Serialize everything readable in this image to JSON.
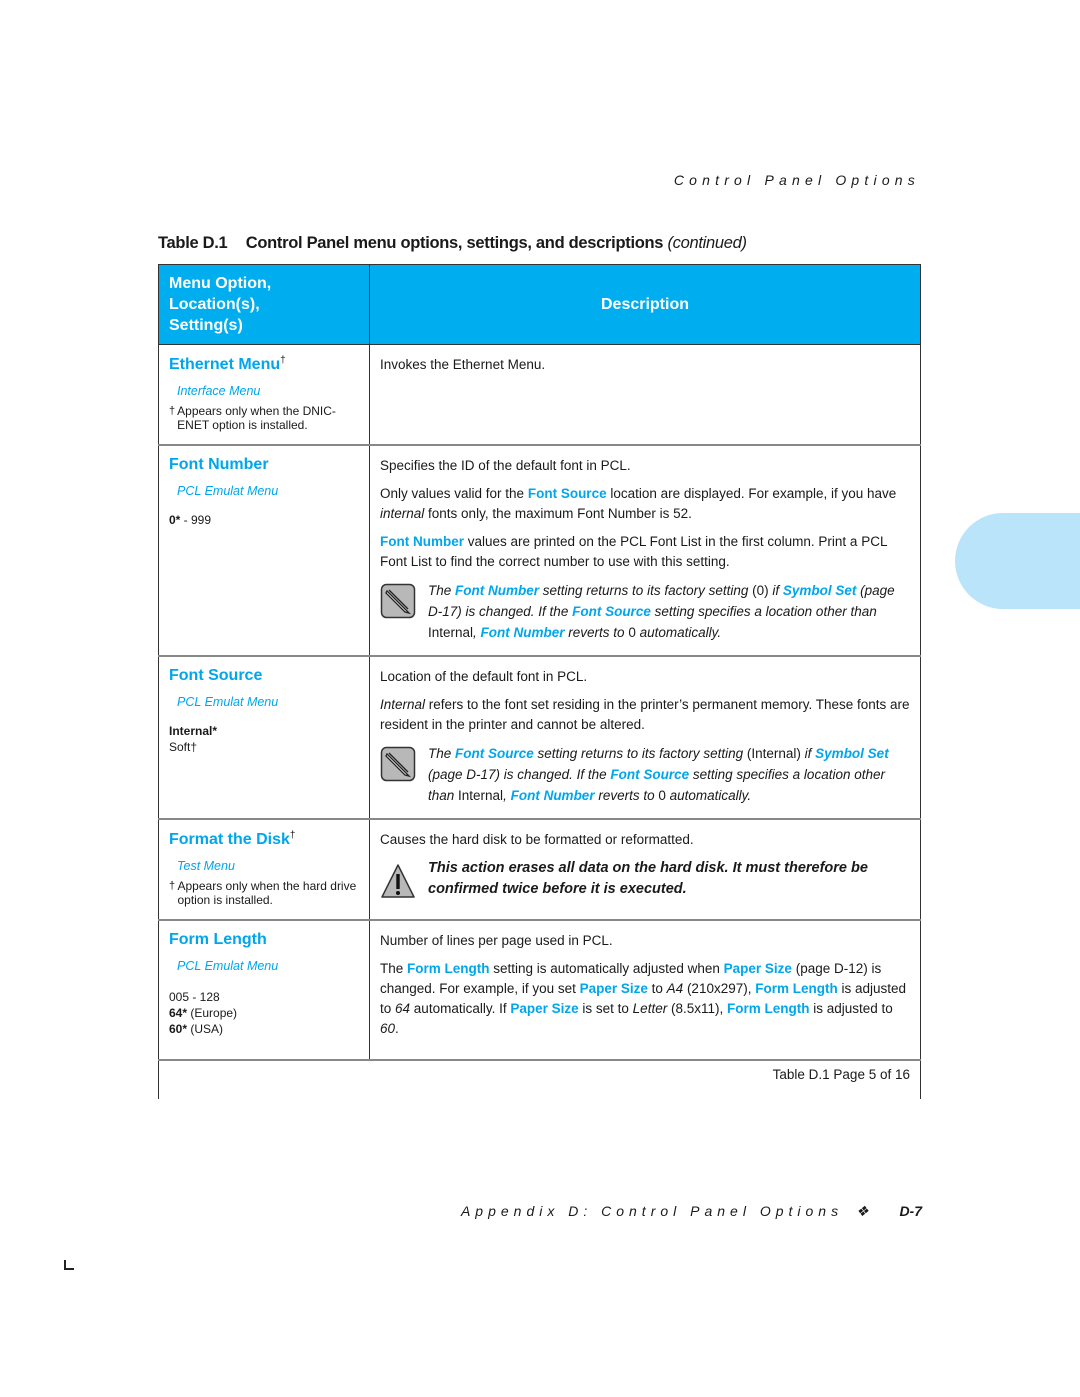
{
  "running_head": "Control Panel Options",
  "table_title": {
    "number": "Table D.1",
    "text": "Control Panel menu options, settings, and descriptions",
    "continued": "(continued)"
  },
  "header": {
    "left_line1": "Menu Option,",
    "left_line2": "Location(s),",
    "left_line3": "Setting(s)",
    "right": "Description"
  },
  "colors": {
    "accent": "#00a6ec",
    "header_bg": "#00adee",
    "tab": "#bae4fa"
  },
  "rows": [
    {
      "option": "Ethernet Menu",
      "dagger": "†",
      "location": "Interface Menu",
      "footnote": "Appears only when the DNIC-ENET option is installed.",
      "desc1": "Invokes the Ethernet Menu."
    },
    {
      "option": "Font Number",
      "location": "PCL Emulat Menu",
      "setting_default": "0*",
      "setting_range": " - 999",
      "desc1": "Specifies the ID of the default font in PCL.",
      "desc2_a": "Only values valid for the ",
      "desc2_kw": "Font Source",
      "desc2_b": " location are displayed. For example, if you have ",
      "desc2_i": "internal",
      "desc2_c": " fonts only, the maximum Font Number is 52.",
      "desc3_kw": "Font Number",
      "desc3_b": " values are printed on the PCL Font List in the first column. Print a PCL Font List to find the correct number to use with this setting.",
      "note": {
        "icon": "pencil-note-icon",
        "t1": "The ",
        "k1": "Font Number",
        "t2": " setting returns to its factory setting ",
        "u1": "(0)",
        "t3": " if ",
        "k2": "Symbol Set",
        "t4": " (page D-17) is changed. If the ",
        "k3": "Font Source",
        "t5": " setting specifies a location other than ",
        "u2": "Internal",
        "t6": ", ",
        "k4": "Font Number",
        "t7": " reverts to ",
        "u3": "0",
        "t8": " automatically."
      }
    },
    {
      "option": "Font Source",
      "location": "PCL Emulat Menu",
      "setting_default": "Internal*",
      "setting_other": "Soft†",
      "desc1": "Location of the default font in PCL.",
      "desc2_i": "Internal",
      "desc2_b": " refers to the font set residing in the printer’s permanent memory. These fonts are resident in the printer and cannot be altered.",
      "note": {
        "icon": "pencil-note-icon",
        "t1": "The ",
        "k1": "Font Source",
        "t2": " setting returns to its factory setting ",
        "u1": "(Internal)",
        "t3": " if ",
        "k2": "Symbol Set",
        "t4": " (page D-17) is changed. If the ",
        "k3": "Font Source",
        "t5": " setting specifies a location other than ",
        "u2": "Internal",
        "t6": ", ",
        "k4": "Font Number",
        "t7": " reverts to ",
        "u3": "0",
        "t8": " automatically."
      }
    },
    {
      "option": "Format the Disk",
      "dagger": "†",
      "location": "Test Menu",
      "footnote": "Appears only when the hard drive option is installed.",
      "desc1": "Causes the hard disk to be formatted or reformatted.",
      "warning": {
        "icon": "warning-triangle-icon",
        "text": "This action erases all data on the hard disk. It must therefore be confirmed twice before it is executed."
      }
    },
    {
      "option": "Form Length",
      "location": "PCL Emulat Menu",
      "setting_range": "005 - 128",
      "setting_eu_val": "64*",
      "setting_eu_lbl": " (Europe)",
      "setting_us_val": "60*",
      "setting_us_lbl": " (USA)",
      "desc1": "Number of lines per page used in PCL.",
      "d": {
        "t1": "The ",
        "k1": "Form Length",
        "t2": " setting is automatically adjusted when ",
        "k2": "Paper Size",
        "t3": " (page D-12) is changed. For example, if you set ",
        "k3": "Paper Size",
        "t4": " to ",
        "i1": "A4",
        "t5": " (210x297), ",
        "k4": "Form Length",
        "t6": " is adjusted to ",
        "i2": "64",
        "t7": " automatically. If ",
        "k5": "Paper Size",
        "t8": " is set to ",
        "i3": "Letter",
        "t9": " (8.5x11), ",
        "k6": "Form Length",
        "t10": " is adjusted to ",
        "i4": "60",
        "t11": "."
      }
    }
  ],
  "table_footer": "Table D.1  Page 5 of 16",
  "page_footer": {
    "text": "Appendix D: Control Panel Options",
    "bullet": "❖",
    "folio": "D-7"
  }
}
